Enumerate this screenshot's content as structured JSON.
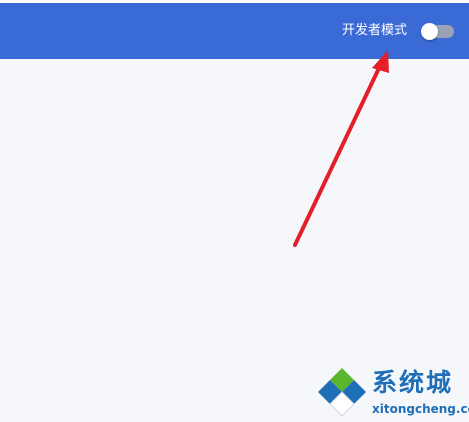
{
  "header": {
    "developer_mode_label": "开发者模式",
    "developer_mode_enabled": false
  },
  "watermark": {
    "name": "系统城",
    "url": "xitongcheng.com"
  },
  "colors": {
    "header_bg": "#3a6ad6",
    "page_bg": "#f6f7fb",
    "arrow": "#e21f2a",
    "toggle_track": "#9aa3b6",
    "watermark_blue": "#1f6fb8",
    "watermark_green": "#5bb52f"
  }
}
